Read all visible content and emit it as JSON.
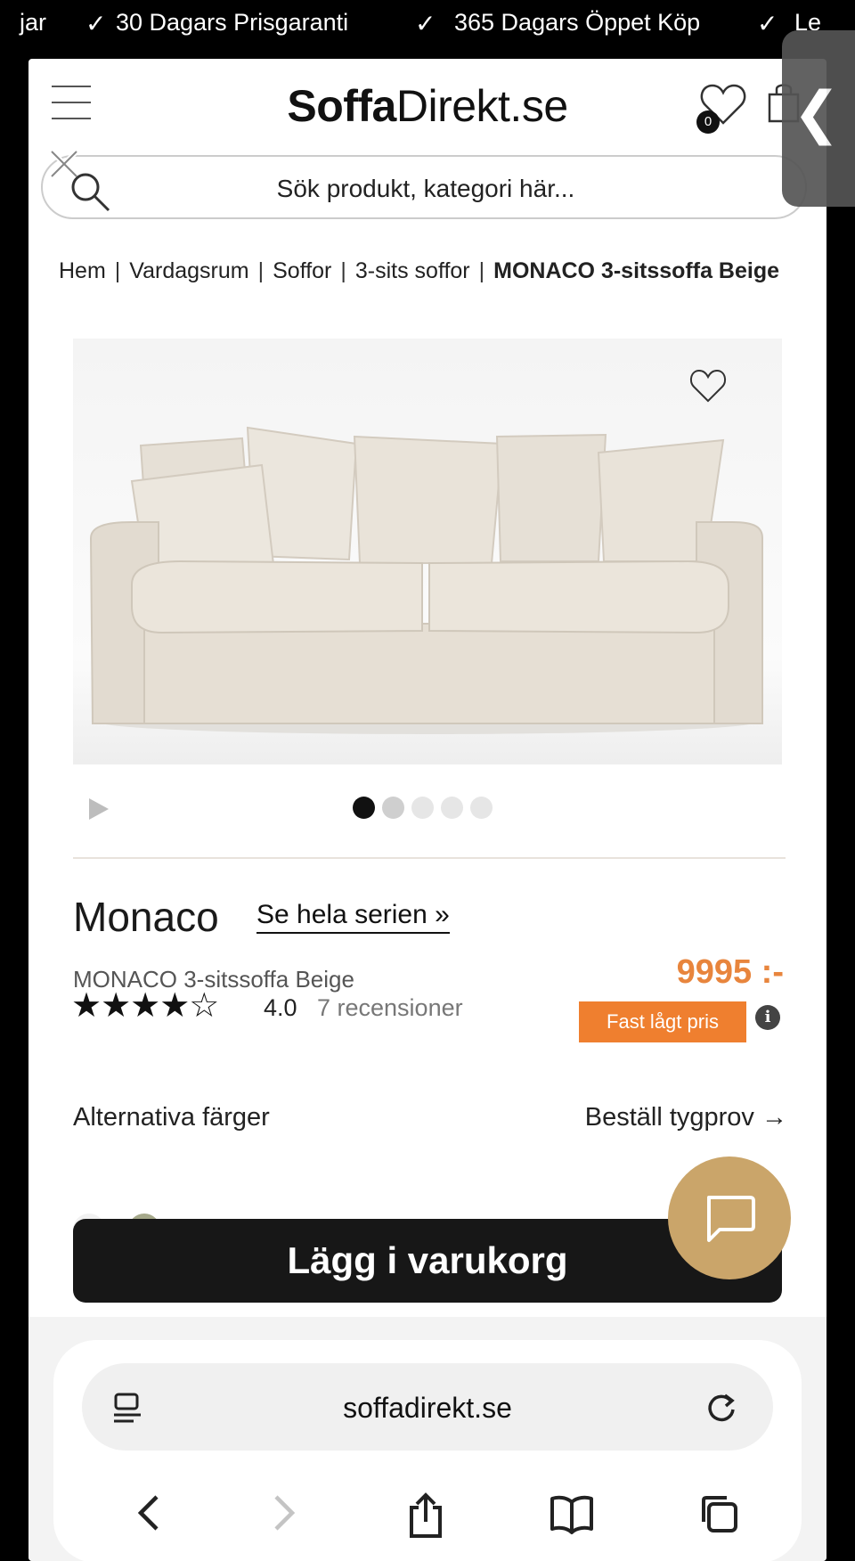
{
  "ticker": {
    "items": [
      "jar",
      "30 Dagars Prisgaranti",
      "365 Dagars Öppet Köp",
      "Le"
    ],
    "check": "✓"
  },
  "header": {
    "logo_bold": "Soffa",
    "logo_rest": "Direkt.se",
    "wishlist_count": "0",
    "side_tab_glyph": "❮"
  },
  "search": {
    "placeholder": "Sök produkt, kategori här..."
  },
  "breadcrumb": {
    "items": [
      "Hem",
      "Vardagsrum",
      "Soffor",
      "3-sits soffor"
    ],
    "current": "MONACO 3-sitssoffa Beige"
  },
  "gallery": {
    "image_count": 5,
    "active_index": 1
  },
  "product": {
    "series": "Monaco",
    "series_link": "Se hela serien »",
    "name": "MONACO 3-sitssoffa Beige",
    "stars": "★★★★☆",
    "rating": "4.0",
    "reviews": "7 recensioner",
    "price": "9995 :-",
    "price_badge": "Fast lågt pris",
    "info_glyph": "i"
  },
  "colors": {
    "label": "Alternativa färger",
    "sample_link": "Beställ tygprov →",
    "swatches": [
      "#f1f1f1",
      "#a5a88a"
    ]
  },
  "cart_button": "Lägg i varukorg",
  "browser": {
    "url": "soffadirekt.se"
  },
  "theme": {
    "accent": "#ef7f2f",
    "chat": "#caa56a",
    "cta": "#171717"
  }
}
